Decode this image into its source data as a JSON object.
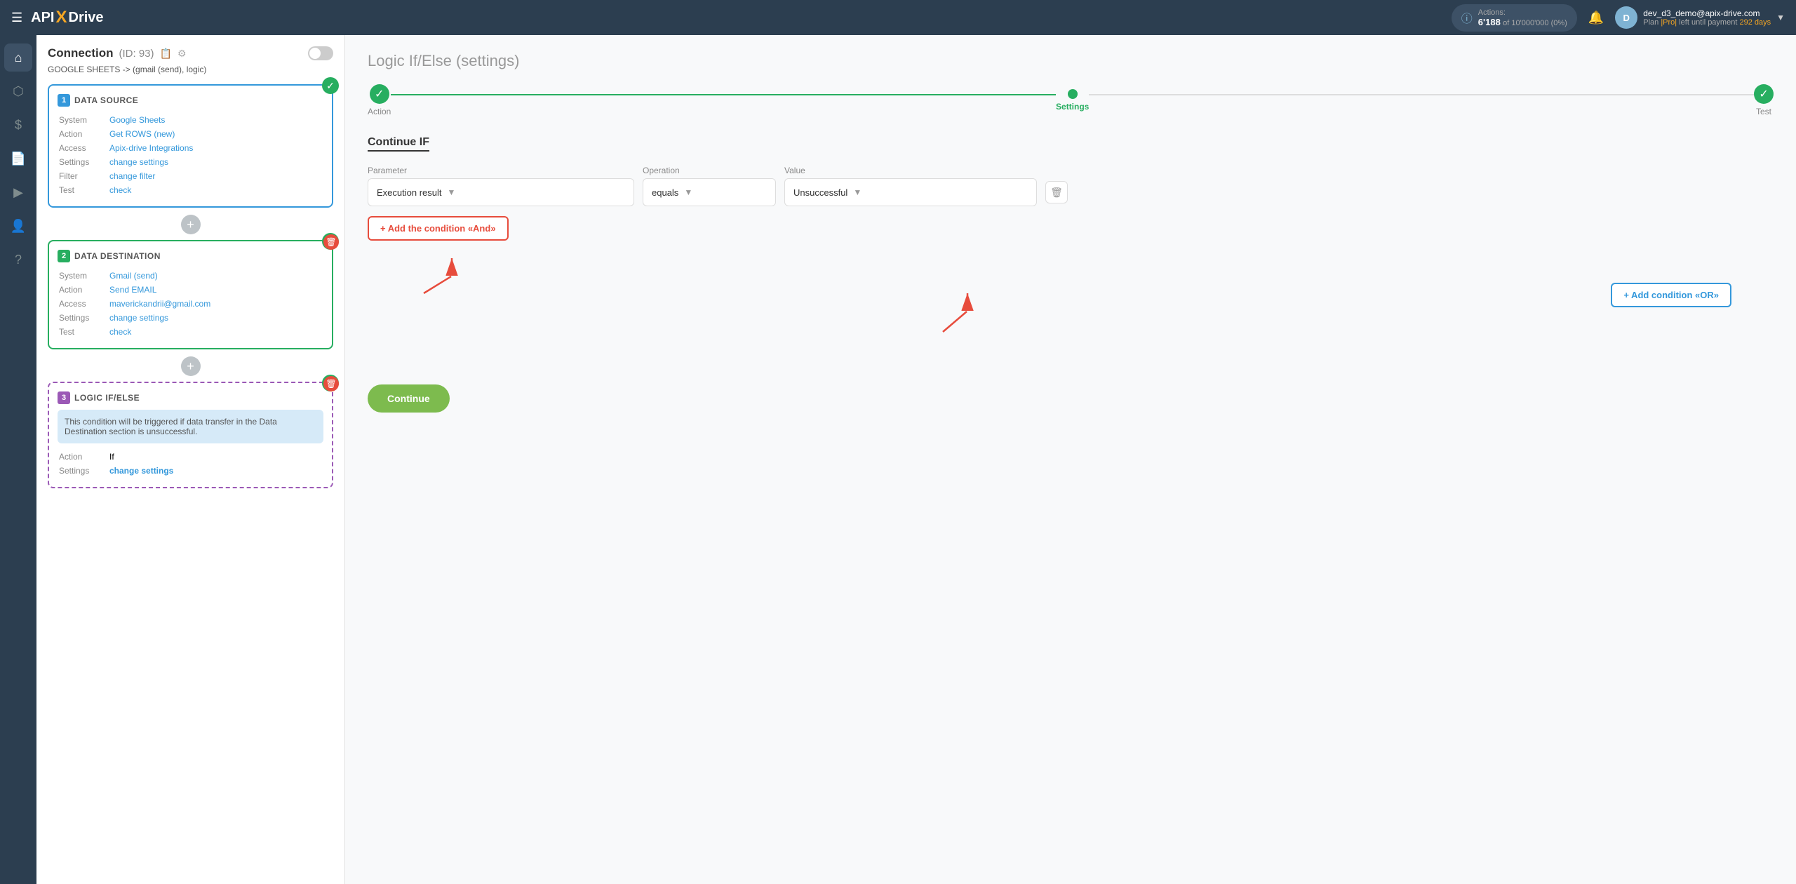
{
  "topNav": {
    "logoApi": "API",
    "logoX": "X",
    "logoDrive": "Drive",
    "actions": {
      "label": "Actions:",
      "count": "6'188",
      "total": "of 10'000'000",
      "pct": "(0%)"
    },
    "user": {
      "email": "dev_d3_demo@apix-drive.com",
      "plan": "Plan |Pro| left until payment",
      "days": "292 days"
    }
  },
  "sidebar": {
    "items": [
      {
        "icon": "⌂",
        "name": "home"
      },
      {
        "icon": "⬡",
        "name": "network"
      },
      {
        "icon": "$",
        "name": "billing"
      },
      {
        "icon": "🗂",
        "name": "connections"
      },
      {
        "icon": "▶",
        "name": "play"
      },
      {
        "icon": "👤",
        "name": "profile"
      },
      {
        "icon": "?",
        "name": "help"
      }
    ]
  },
  "leftPanel": {
    "connectionTitle": "Connection",
    "connectionId": "(ID: 93)",
    "connectionSubtitle": "GOOGLE SHEETS -> (gmail (send), logic)",
    "sections": [
      {
        "num": "1",
        "type": "blue",
        "label": "DATA SOURCE",
        "rows": [
          {
            "key": "System",
            "value": "Google Sheets",
            "isLink": true
          },
          {
            "key": "Action",
            "value": "Get ROWS (new)",
            "isLink": true
          },
          {
            "key": "Access",
            "value": "Apix-drive Integrations",
            "isLink": true
          },
          {
            "key": "Settings",
            "value": "change settings",
            "isLink": true
          },
          {
            "key": "Filter",
            "value": "change filter",
            "isLink": true
          },
          {
            "key": "Test",
            "value": "check",
            "isLink": true
          }
        ],
        "status": "done"
      },
      {
        "num": "2",
        "type": "green",
        "label": "DATA DESTINATION",
        "rows": [
          {
            "key": "System",
            "value": "Gmail (send)",
            "isLink": true
          },
          {
            "key": "Action",
            "value": "Send EMAIL",
            "isLink": true
          },
          {
            "key": "Access",
            "value": "maverickandrii@gmail.com",
            "isLink": true
          },
          {
            "key": "Settings",
            "value": "change settings",
            "isLink": true
          },
          {
            "key": "Test",
            "value": "check",
            "isLink": true
          }
        ],
        "status": "done"
      },
      {
        "num": "3",
        "type": "purple",
        "label": "LOGIC IF/ELSE",
        "description": "This condition will be triggered if data transfer in the Data Destination section is unsuccessful.",
        "rows": [
          {
            "key": "Action",
            "value": "If",
            "isLink": false
          },
          {
            "key": "Settings",
            "value": "change settings",
            "isLink": true
          }
        ],
        "status": "done"
      }
    ]
  },
  "rightPanel": {
    "pageTitle": "Logic If/Else",
    "pageTitleSub": "(settings)",
    "steps": [
      {
        "label": "Action",
        "type": "done"
      },
      {
        "label": "Settings",
        "type": "active"
      },
      {
        "label": "Test",
        "type": "done"
      }
    ],
    "continueIf": {
      "title": "Continue IF",
      "filterRow": {
        "paramLabel": "Parameter",
        "paramValue": "Execution result",
        "opLabel": "Operation",
        "opValue": "equals",
        "valLabel": "Value",
        "valValue": "Unsuccessful"
      },
      "addAndLabel": "+ Add the condition «And»",
      "addOrLabel": "+ Add condition «OR»",
      "continueLabel": "Continue"
    }
  }
}
